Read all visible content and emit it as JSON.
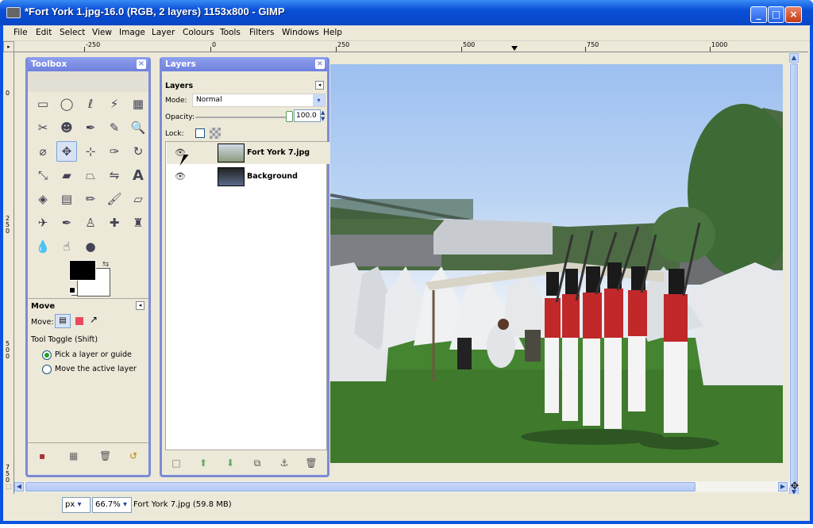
{
  "window": {
    "title": "*Fort York 1.jpg-16.0 (RGB, 2 layers) 1153x800 - GIMP"
  },
  "menu": [
    "File",
    "Edit",
    "Select",
    "View",
    "Image",
    "Layer",
    "Colours",
    "Tools",
    "Filters",
    "Windows",
    "Help"
  ],
  "ruler": {
    "h_ticks": [
      "-250",
      "0",
      "250",
      "500",
      "750",
      "1000"
    ],
    "v_ticks": [
      "0",
      "250",
      "500",
      "750"
    ]
  },
  "toolbox": {
    "title": "Toolbox",
    "tools": [
      [
        "rect-select-icon",
        "ellipse-select-icon",
        "lasso-icon",
        "magic-wand-icon",
        "color-select-icon"
      ],
      [
        "scissors-icon",
        "foreground-select-icon",
        "paths-icon",
        "color-picker-icon",
        "zoom-icon"
      ],
      [
        "measure-icon",
        "move-icon",
        "align-icon",
        "crop-icon",
        "rotate-icon"
      ],
      [
        "scale-icon",
        "shear-icon",
        "perspective-icon",
        "flip-icon",
        "text-icon"
      ],
      [
        "bucket-fill-icon",
        "blend-icon",
        "pencil-icon",
        "paintbrush-icon",
        "eraser-icon"
      ],
      [
        "airbrush-icon",
        "ink-icon",
        "clone-icon",
        "heal-icon",
        "perspective-clone-icon"
      ],
      [
        "blur-icon",
        "smudge-icon",
        "dodge-burn-icon"
      ]
    ],
    "fg_color": "#000000",
    "bg_color": "#ffffff",
    "options": {
      "title": "Move",
      "move_label": "Move:",
      "toggle_label": "Tool Toggle  (Shift)",
      "option1": "Pick a layer or guide",
      "option2": "Move the active layer"
    }
  },
  "layers": {
    "title": "Layers",
    "section": "Layers",
    "mode_label": "Mode:",
    "mode_value": "Normal",
    "opacity_label": "Opacity:",
    "opacity_value": "100.0",
    "lock_label": "Lock:",
    "items": [
      {
        "name": "Fort York 7.jpg",
        "visible": true
      },
      {
        "name": "Background",
        "visible": true
      }
    ]
  },
  "status": {
    "unit": "px",
    "zoom": "66.7%",
    "info": "Fort York 7.jpg (59.8 MB)"
  },
  "colors": {
    "titlebar": "#0a4fd8",
    "dock_border": "#7d8ad8",
    "grass": "#3f7a2c"
  }
}
